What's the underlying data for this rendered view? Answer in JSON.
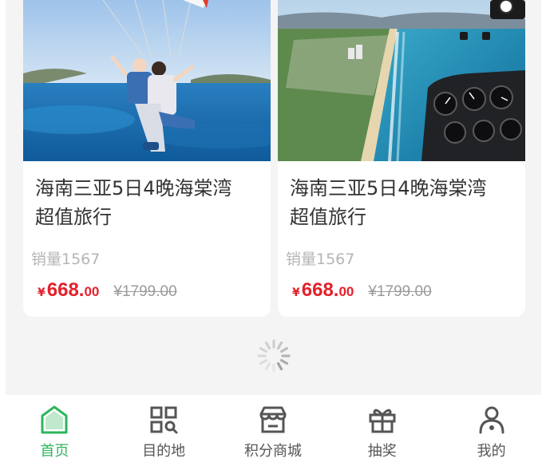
{
  "products": [
    {
      "image_subject": "paragliding couple above a blue bay",
      "title_line1": "海南三亚5日4晚海棠湾",
      "title_line2": "超值旅行",
      "sales": "销量1567",
      "currency": "¥",
      "price_int": "668.",
      "price_dec": "00",
      "original_price": "¥1799.00"
    },
    {
      "image_subject": "view of the coastline from a helicopter cockpit",
      "title_line1": "海南三亚5日4晚海棠湾",
      "title_line2": "超值旅行",
      "sales": "销量1567",
      "currency": "¥",
      "price_int": "668.",
      "price_dec": "00",
      "original_price": "¥1799.00"
    }
  ],
  "loading_icon": "spinner-icon",
  "tabbar": {
    "active_index": 0,
    "items": [
      {
        "label": "首页",
        "icon": "home-icon"
      },
      {
        "label": "目的地",
        "icon": "qr-grid-icon"
      },
      {
        "label": "积分商城",
        "icon": "store-icon"
      },
      {
        "label": "抽奖",
        "icon": "gift-icon"
      },
      {
        "label": "我的",
        "icon": "profile-icon"
      }
    ]
  },
  "colors": {
    "accent": "#2db55d",
    "price": "#e4202a",
    "muted": "#b5b5b5",
    "background": "#f4f4f4"
  }
}
